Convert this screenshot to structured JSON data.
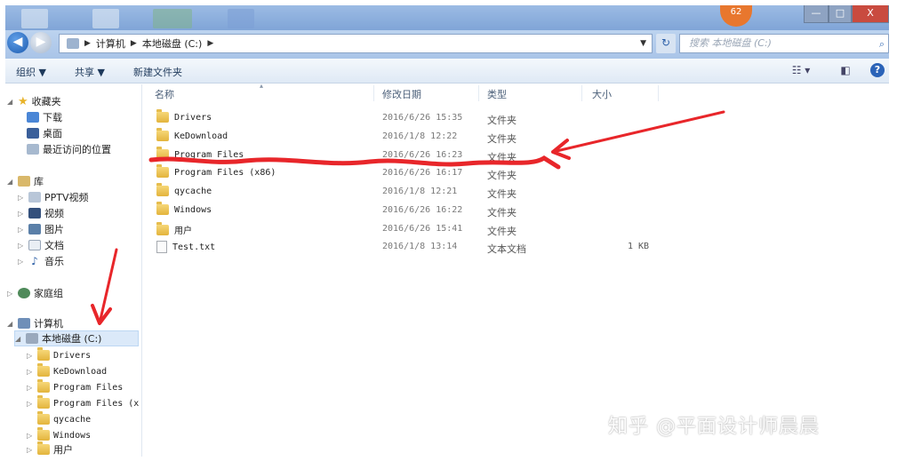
{
  "titlebar": {
    "badge": "62",
    "minimize": "—",
    "maximize": "□",
    "close": "X"
  },
  "address": {
    "crumbs": [
      "计算机",
      "本地磁盘 (C:)"
    ],
    "search_placeholder": "搜索 本地磁盘 (C:)"
  },
  "toolbar": {
    "organize": "组织 ▼",
    "share": "共享 ▼",
    "new_folder": "新建文件夹"
  },
  "nav": {
    "favorites": {
      "label": "收藏夹",
      "items": [
        "下载",
        "桌面",
        "最近访问的位置"
      ]
    },
    "libraries": {
      "label": "库",
      "items": [
        "PPTV视频",
        "视频",
        "图片",
        "文档",
        "音乐"
      ]
    },
    "homegroup": "家庭组",
    "computer": "计算机",
    "drive": "本地磁盘 (C:)",
    "drive_children": [
      "Drivers",
      "KeDownload",
      "Program Files",
      "Program Files (x",
      "qycache",
      "Windows",
      "用户"
    ]
  },
  "columns": {
    "name": "名称",
    "date": "修改日期",
    "type": "类型",
    "size": "大小"
  },
  "files": [
    {
      "name": "Drivers",
      "date": "2016/6/26 15:35",
      "type": "文件夹",
      "size": "",
      "icon": "folder"
    },
    {
      "name": "KeDownload",
      "date": "2016/1/8 12:22",
      "type": "文件夹",
      "size": "",
      "icon": "folder"
    },
    {
      "name": "Program Files",
      "date": "2016/6/26 16:23",
      "type": "文件夹",
      "size": "",
      "icon": "folder"
    },
    {
      "name": "Program Files (x86)",
      "date": "2016/6/26 16:17",
      "type": "文件夹",
      "size": "",
      "icon": "folder"
    },
    {
      "name": "qycache",
      "date": "2016/1/8 12:21",
      "type": "文件夹",
      "size": "",
      "icon": "folder"
    },
    {
      "name": "Windows",
      "date": "2016/6/26 16:22",
      "type": "文件夹",
      "size": "",
      "icon": "folder"
    },
    {
      "name": "用户",
      "date": "2016/6/26 15:41",
      "type": "文件夹",
      "size": "",
      "icon": "folder"
    },
    {
      "name": "Test.txt",
      "date": "2016/1/8 13:14",
      "type": "文本文档",
      "size": "1 KB",
      "icon": "text-file"
    }
  ],
  "watermark": "知乎 @平面设计师晨晨",
  "colors": {
    "annotation": "#e8262a",
    "selection": "#dbe9f9",
    "address_bar": "#a9c4e8"
  }
}
